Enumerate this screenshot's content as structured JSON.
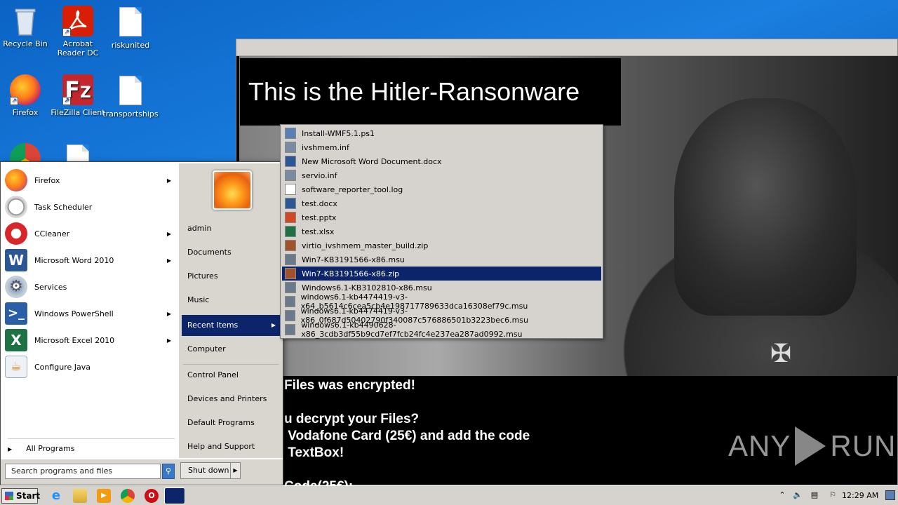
{
  "desktop": {
    "icons": [
      {
        "label": "Recycle Bin"
      },
      {
        "label": "Acrobat Reader DC"
      },
      {
        "label": "riskunited"
      },
      {
        "label": "Firefox"
      },
      {
        "label": "FileZilla Client"
      },
      {
        "label": "transportships"
      }
    ]
  },
  "ransom_window": {
    "headline": "This is the Hitler-Ransonware",
    "message": "Files was encrypted!\n\nu decrypt your Files?\n Vodafone Card (25€) and add the code\n TextBox!\n\nCode(25€):"
  },
  "watermark": {
    "left": "ANY",
    "right": "RUN"
  },
  "start_menu": {
    "programs": [
      {
        "label": "Firefox",
        "has_arrow": true,
        "icon": "firefox-icon",
        "color": "#ff7a1a"
      },
      {
        "label": "Task Scheduler",
        "has_arrow": false,
        "icon": "clock-icon",
        "color": "#c9c9c9"
      },
      {
        "label": "CCleaner",
        "has_arrow": true,
        "icon": "ccleaner-icon",
        "color": "#d8262b"
      },
      {
        "label": "Microsoft Word 2010",
        "has_arrow": true,
        "icon": "word-icon",
        "color": "#2b5797"
      },
      {
        "label": "Services",
        "has_arrow": false,
        "icon": "gear-icon",
        "color": "#9aa8b8"
      },
      {
        "label": "Windows PowerShell",
        "has_arrow": true,
        "icon": "powershell-icon",
        "color": "#2a5fa8"
      },
      {
        "label": "Microsoft Excel 2010",
        "has_arrow": true,
        "icon": "excel-icon",
        "color": "#1e7145"
      },
      {
        "label": "Configure Java",
        "has_arrow": false,
        "icon": "java-icon",
        "color": "#e07b16"
      }
    ],
    "all_programs": "All Programs",
    "search_placeholder": "Search programs and files",
    "shutdown_label": "Shut down",
    "right_items": {
      "user": "admin",
      "documents": "Documents",
      "pictures": "Pictures",
      "music": "Music",
      "recent": "Recent Items",
      "computer": "Computer",
      "control_panel": "Control Panel",
      "devices": "Devices and Printers",
      "default_programs": "Default Programs",
      "help": "Help and Support"
    }
  },
  "recent_items": [
    {
      "name": "Install-WMF5.1.ps1",
      "type": "ps1",
      "color": "#5b7fb5"
    },
    {
      "name": "ivshmem.inf",
      "type": "inf",
      "color": "#7a8aa0"
    },
    {
      "name": "New Microsoft Word Document.docx",
      "type": "docx",
      "color": "#2b5797"
    },
    {
      "name": "servio.inf",
      "type": "inf",
      "color": "#7a8aa0"
    },
    {
      "name": "software_reporter_tool.log",
      "type": "log",
      "color": "#ffffff"
    },
    {
      "name": "test.docx",
      "type": "docx",
      "color": "#2b5797"
    },
    {
      "name": "test.pptx",
      "type": "pptx",
      "color": "#d24726"
    },
    {
      "name": "test.xlsx",
      "type": "xlsx",
      "color": "#1e7145"
    },
    {
      "name": "virtio_ivshmem_master_build.zip",
      "type": "zip",
      "color": "#a0522d"
    },
    {
      "name": "Win7-KB3191566-x86.msu",
      "type": "msu",
      "color": "#6a7a8a"
    },
    {
      "name": "Win7-KB3191566-x86.zip",
      "type": "zip",
      "color": "#a0522d",
      "selected": true
    },
    {
      "name": "Windows6.1-KB3102810-x86.msu",
      "type": "msu",
      "color": "#6a7a8a"
    },
    {
      "name": "windows6.1-kb4474419-v3-x64_b5614c6cea5cb4e198717789633dca16308ef79c.msu",
      "type": "msu",
      "color": "#6a7a8a"
    },
    {
      "name": "windows6.1-kb4474419-v3-x86_0f687d50402790f340087c576886501b3223bec6.msu",
      "type": "msu",
      "color": "#6a7a8a"
    },
    {
      "name": "windows6.1-kb4490628-x86_3cdb3df55b9cd7ef7fcb24fc4e237ea287ad0992.msu",
      "type": "msu",
      "color": "#6a7a8a"
    }
  ],
  "taskbar": {
    "start_label": "Start",
    "clock": "12:29 AM"
  }
}
